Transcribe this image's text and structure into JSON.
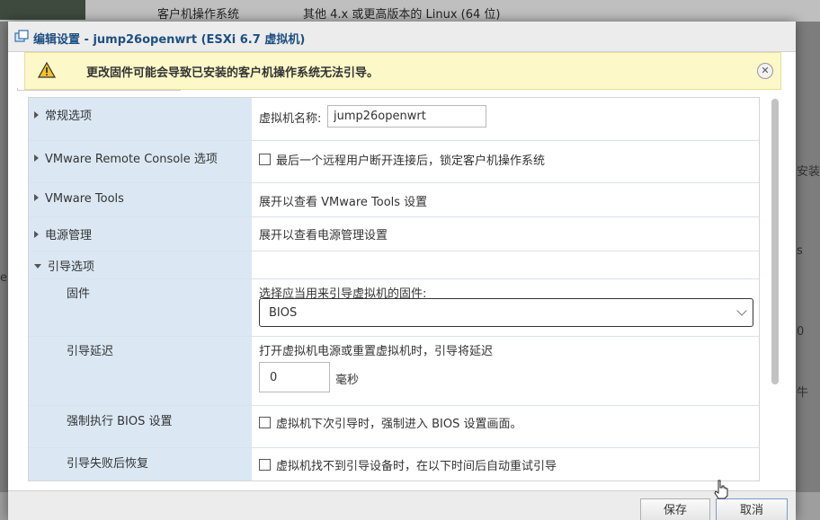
{
  "background": {
    "row_label": "客户机操作系统",
    "row_value": "其他 4.x 或更高版本的 Linux (64 位)",
    "right_fragment_1": "安装",
    "right_fragment_2": "s",
    "right_fragment_3": "0",
    "right_fragment_4": "牛",
    "left_fragment": "e"
  },
  "dialog": {
    "title": "编辑设置 - jump26openwrt (ESXi 6.7 虚拟机)",
    "title_icon": "vm-settings-icon",
    "warning": {
      "icon": "warning-icon",
      "text": "更改固件可能会导致已安装的客户机操作系统无法引导。",
      "close_glyph": "✕"
    },
    "rows": {
      "general": {
        "label": "常规选项",
        "vm_name_label": "虚拟机名称:",
        "vm_name_value": "jump26openwrt"
      },
      "remote_console": {
        "label": "VMware Remote Console 选项",
        "checkbox_label": "最后一个远程用户断开连接后，锁定客户机操作系统",
        "checked": false
      },
      "vmware_tools": {
        "label": "VMware Tools",
        "value": "展开以查看 VMware Tools 设置"
      },
      "power": {
        "label": "电源管理",
        "value": "展开以查看电源管理设置"
      },
      "boot": {
        "label": "引导选项",
        "expanded": true
      },
      "firmware": {
        "label": "固件",
        "prompt": "选择应当用来引导虚拟机的固件:",
        "selected": "BIOS"
      },
      "boot_delay": {
        "label": "引导延迟",
        "prompt": "打开虚拟机电源或重置虚拟机时，引导将延迟",
        "value": "0",
        "unit": "毫秒"
      },
      "force_bios": {
        "label": "强制执行 BIOS 设置",
        "checkbox_label": "虚拟机下次引导时，强制进入 BIOS 设置画面。",
        "checked": false
      },
      "boot_retry": {
        "label": "引导失败后恢复",
        "checkbox_label": "虚拟机找不到引导设备时，在以下时间后自动重试引导",
        "checked": false
      }
    },
    "footer": {
      "save_label": "保存",
      "cancel_label": "取消"
    }
  }
}
